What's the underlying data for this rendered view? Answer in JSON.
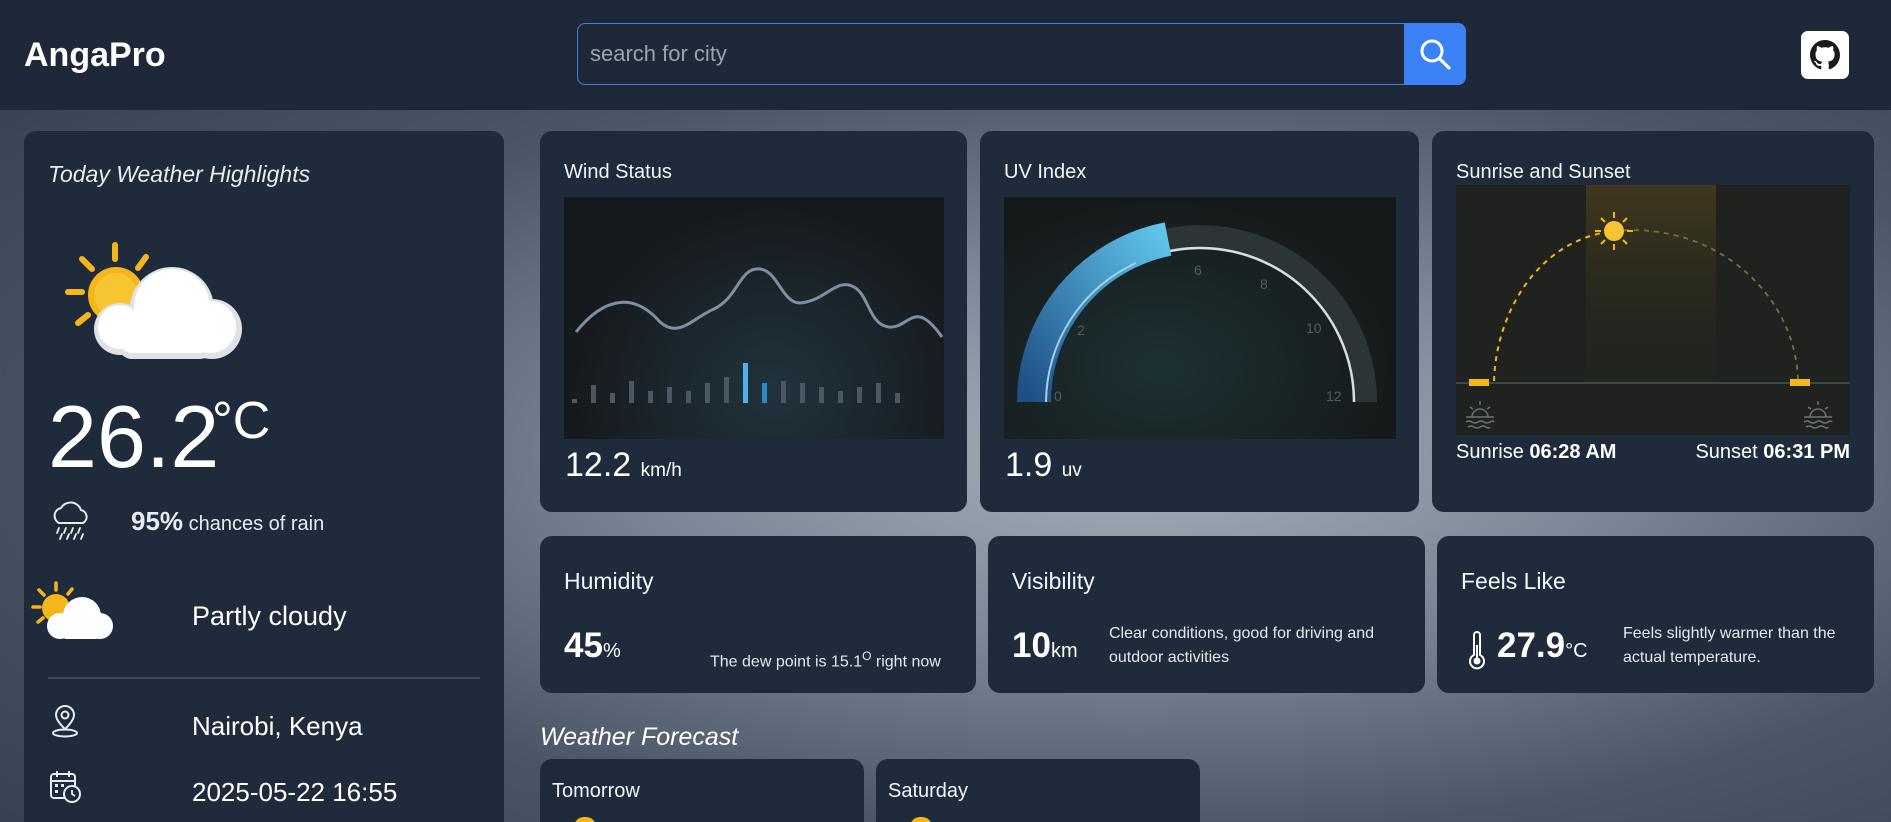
{
  "header": {
    "logo": "AngaPro",
    "search_placeholder": "search for city",
    "search_icon": "search-icon",
    "github_icon": "github-icon"
  },
  "today": {
    "title": "Today Weather Highlights",
    "temperature": "26.2",
    "temperature_unit": "°C",
    "rain_percent": "95%",
    "rain_label": "chances of rain",
    "condition": "Partly cloudy",
    "location": "Nairobi, Kenya",
    "datetime": "2025-05-22 16:55"
  },
  "wind": {
    "title": "Wind Status",
    "value": "12.2",
    "unit": "km/h"
  },
  "uv": {
    "title": "UV Index",
    "value": "1.9",
    "unit": "uv",
    "gauge_ticks": [
      "0",
      "2",
      "6",
      "8",
      "10",
      "12"
    ]
  },
  "sun": {
    "title": "Sunrise and Sunset",
    "sunrise_label": "Sunrise",
    "sunrise_time": "06:28 AM",
    "sunset_label": "Sunset",
    "sunset_time": "06:31 PM"
  },
  "humidity": {
    "title": "Humidity",
    "value": "45",
    "unit": "%",
    "note_prefix": "The dew point is 15.1",
    "note_degree": "O",
    "note_suffix": " right now"
  },
  "visibility": {
    "title": "Visibility",
    "value": "10",
    "unit": "km",
    "note": "Clear conditions, good for driving and outdoor activities"
  },
  "feels_like": {
    "title": "Feels Like",
    "value": "27.9",
    "unit": "°C",
    "note": "Feels slightly warmer than the actual temperature."
  },
  "forecast": {
    "title": "Weather Forecast",
    "days": [
      "Tomorrow",
      "Saturday"
    ]
  },
  "colors": {
    "accent": "#3b82f6",
    "card_bg": "#1f2a3b",
    "sun_yellow": "#f4b619"
  }
}
